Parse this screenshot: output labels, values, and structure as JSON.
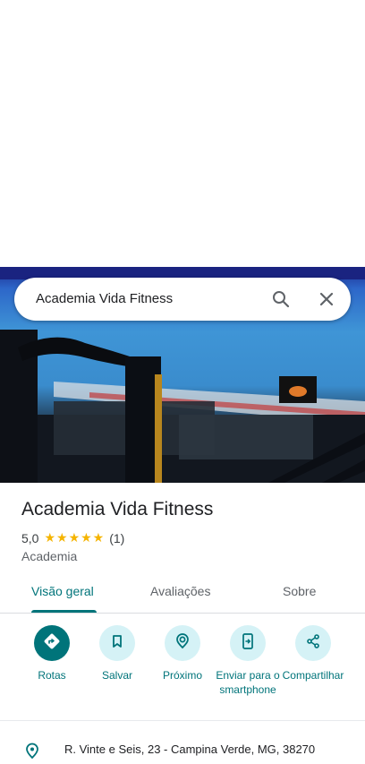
{
  "place": {
    "name": "Academia Vida Fitness",
    "rating": "5,0",
    "stars": "★★★★★",
    "review_count": "(1)",
    "category": "Academia",
    "address": "R. Vinte e Seis, 23 - Campina Verde, MG, 38270"
  },
  "search": {
    "query": "Academia Vida Fitness"
  },
  "tabs": [
    {
      "label": "Visão geral",
      "active": true
    },
    {
      "label": "Avaliações",
      "active": false
    },
    {
      "label": "Sobre",
      "active": false
    }
  ],
  "actions": [
    {
      "label": "Rotas",
      "icon": "directions-icon"
    },
    {
      "label": "Salvar",
      "icon": "bookmark-icon"
    },
    {
      "label": "Próximo",
      "icon": "nearby-icon"
    },
    {
      "label": "Enviar para o smartphone",
      "icon": "send-to-phone-icon"
    },
    {
      "label": "Compartilhar",
      "icon": "share-icon"
    }
  ],
  "colors": {
    "accent": "#00747a",
    "action_bg": "#d5f2f6",
    "star": "#f5b400"
  }
}
